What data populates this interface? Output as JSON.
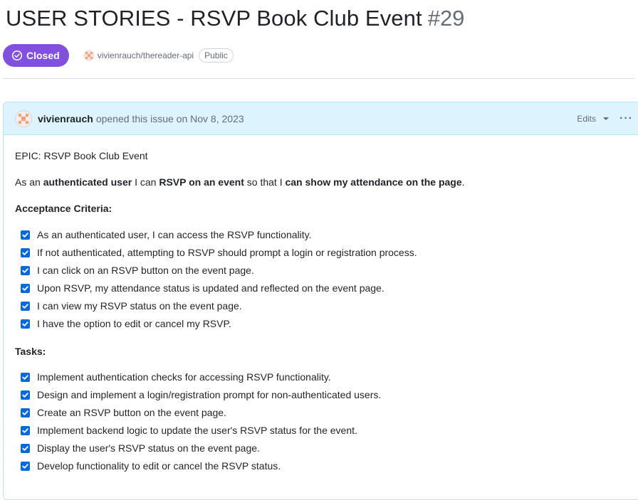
{
  "issue": {
    "title": "USER STORIES - RSVP Book Club Event",
    "number": "#29",
    "state": "Closed",
    "repo": "vivienrauch/thereader-api",
    "visibility": "Public"
  },
  "comment": {
    "author": "vivienrauch",
    "action": "opened this issue on Nov 8, 2023",
    "edits_label": "Edits",
    "epic": "EPIC: RSVP Book Club Event",
    "story": {
      "t1": "As an ",
      "b1": "authenticated user",
      "t2": " I can ",
      "b2": "RSVP on an event",
      "t3": " so that I ",
      "b3": "can show my attendance on the page",
      "t4": "."
    },
    "acceptance_heading": "Acceptance Criteria:",
    "acceptance": [
      "As an authenticated user, I can access the RSVP functionality.",
      "If not authenticated, attempting to RSVP should prompt a login or registration process.",
      "I can click on an RSVP button on the event page.",
      "Upon RSVP, my attendance status is updated and reflected on the event page.",
      "I can view my RSVP status on the event page.",
      "I have the option to edit or cancel my RSVP."
    ],
    "tasks_heading": "Tasks:",
    "tasks": [
      "Implement authentication checks for accessing RSVP functionality.",
      "Design and implement a login/registration prompt for non-authenticated users.",
      "Create an RSVP button on the event page.",
      "Implement backend logic to update the user's RSVP status for the event.",
      "Display the user's RSVP status on the event page.",
      "Develop functionality to edit or cancel the RSVP status."
    ]
  },
  "colors": {
    "closed_badge": "#8250df",
    "checkbox": "#0969da",
    "comment_header_bg": "#ddf4ff"
  }
}
